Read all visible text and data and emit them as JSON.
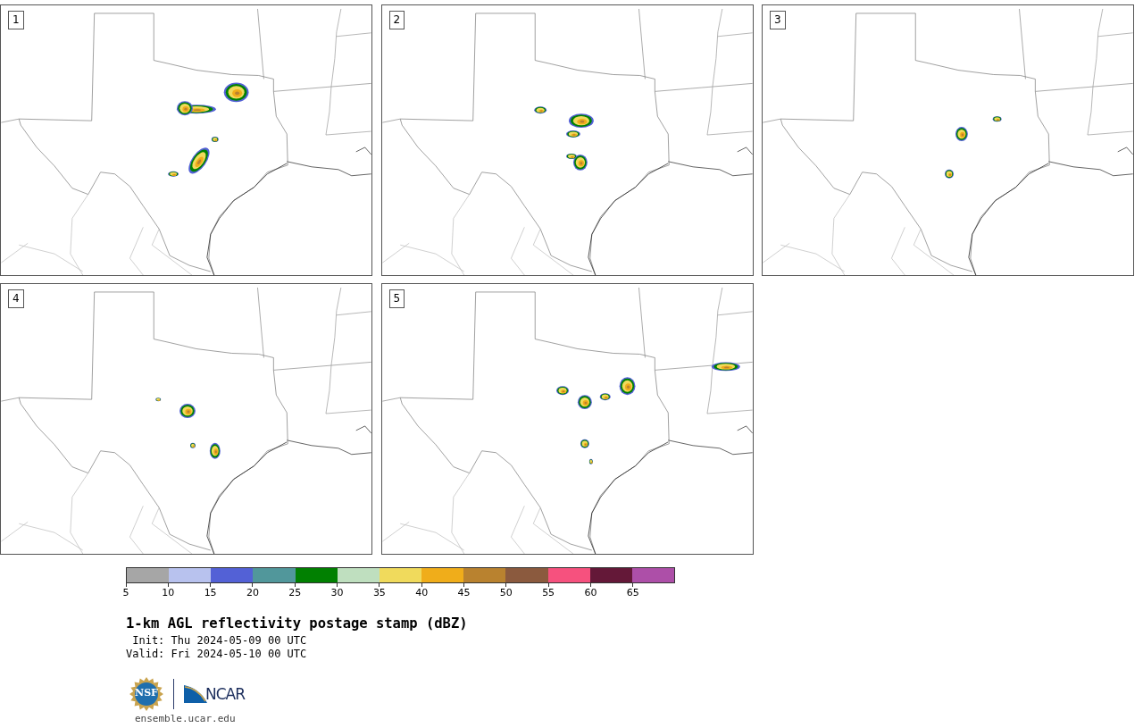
{
  "panels": [
    {
      "label": "1"
    },
    {
      "label": "2"
    },
    {
      "label": "3"
    },
    {
      "label": "4"
    },
    {
      "label": "5"
    }
  ],
  "colorbar": {
    "bins": [
      {
        "color": "#a6a6a6"
      },
      {
        "color": "#b8c2ee"
      },
      {
        "color": "#5361d6"
      },
      {
        "color": "#51979b"
      },
      {
        "color": "#018001"
      },
      {
        "color": "#bfdfbf"
      },
      {
        "color": "#f0da5c"
      },
      {
        "color": "#f0ad1a"
      },
      {
        "color": "#b9822f"
      },
      {
        "color": "#8b5a3e"
      },
      {
        "color": "#f6517e"
      },
      {
        "color": "#641838"
      },
      {
        "color": "#ad4fa8"
      }
    ],
    "ticks": [
      "5",
      "10",
      "15",
      "20",
      "25",
      "30",
      "35",
      "40",
      "45",
      "50",
      "55",
      "60",
      "65"
    ]
  },
  "title": "1-km AGL reflectivity postage stamp (dBZ)",
  "init": " Init: Thu 2024-05-09 00 UTC",
  "valid": "Valid: Fri 2024-05-10 00 UTC",
  "logos": {
    "nsf_text": "NSF",
    "ncar_text": "NCAR"
  },
  "site": "ensemble.ucar.edu"
}
